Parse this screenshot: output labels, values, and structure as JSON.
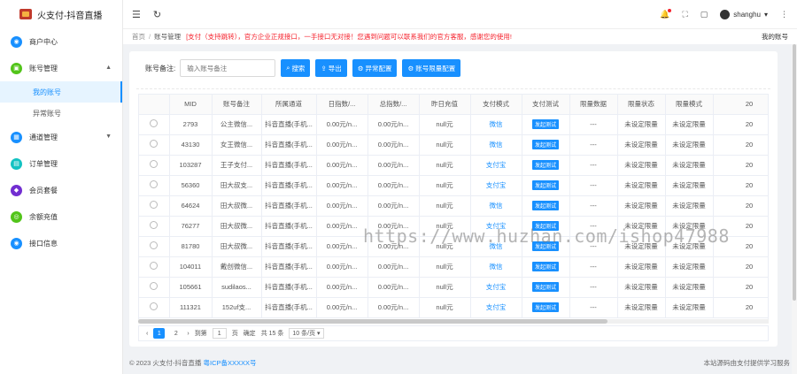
{
  "app": {
    "title": "火支付-抖音直播"
  },
  "sidebar": {
    "items": [
      {
        "label": "商户中心",
        "color": "#1890ff",
        "glyph": "◉"
      },
      {
        "label": "账号管理",
        "color": "#52c41a",
        "glyph": "▣",
        "expanded": true,
        "children": [
          {
            "label": "我的账号",
            "active": true
          },
          {
            "label": "异常账号"
          }
        ]
      },
      {
        "label": "通道管理",
        "color": "#1890ff",
        "glyph": "▦"
      },
      {
        "label": "订单管理",
        "color": "#13c2c2",
        "glyph": "▤"
      },
      {
        "label": "会员套餐",
        "color": "#722ed1",
        "glyph": "◆"
      },
      {
        "label": "余额充值",
        "color": "#52c41a",
        "glyph": "◎"
      },
      {
        "label": "接口信息",
        "color": "#1890ff",
        "glyph": "◉"
      }
    ]
  },
  "header": {
    "username": "shanghu"
  },
  "breadcrumb": {
    "home": "首页",
    "current": "账号管理",
    "notice": "[支付（支持跳转），官方企业正规接口，一手接口无对接！您遇到问题可以联系我们的官方客服，感谢您的使用!",
    "tab": "我的账号"
  },
  "toolbar": {
    "label": "账号备注:",
    "placeholder": "输入账号备注",
    "search": "搜索",
    "export": "导出",
    "abnormal": "异常配置",
    "limit": "账号限量配置"
  },
  "table": {
    "headers": [
      "",
      "MID",
      "账号备注",
      "所属通道",
      "日指数/...",
      "总指数/...",
      "昨日充值",
      "支付模式",
      "支付测试",
      "限量数据",
      "限量状态",
      "限量模式",
      "20"
    ],
    "rows": [
      {
        "mid": "2793",
        "remark": "公主微信...",
        "channel": "抖音直播(手机...",
        "day": "0.00元/n...",
        "total": "0.00元/n...",
        "yesterday": "null元",
        "mode": "微信",
        "test": "发起测试",
        "limit_data": "---",
        "limit_status": "未设定限量",
        "limit_mode": "未设定限量",
        "extra": "20"
      },
      {
        "mid": "43130",
        "remark": "女王微信...",
        "channel": "抖音直播(手机...",
        "day": "0.00元/n...",
        "total": "0.00元/n...",
        "yesterday": "null元",
        "mode": "微信",
        "test": "发起测试",
        "limit_data": "---",
        "limit_status": "未设定限量",
        "limit_mode": "未设定限量",
        "extra": "20"
      },
      {
        "mid": "103287",
        "remark": "王子支付...",
        "channel": "抖音直播(手机...",
        "day": "0.00元/n...",
        "total": "0.00元/n...",
        "yesterday": "null元",
        "mode": "支付宝",
        "test": "发起测试",
        "limit_data": "---",
        "limit_status": "未设定限量",
        "limit_mode": "未设定限量",
        "extra": "20"
      },
      {
        "mid": "56360",
        "remark": "田大叔支...",
        "channel": "抖音直播(手机...",
        "day": "0.00元/n...",
        "total": "0.00元/n...",
        "yesterday": "null元",
        "mode": "支付宝",
        "test": "发起测试",
        "limit_data": "---",
        "limit_status": "未设定限量",
        "limit_mode": "未设定限量",
        "extra": "20"
      },
      {
        "mid": "64624",
        "remark": "田大叔微...",
        "channel": "抖音直播(手机...",
        "day": "0.00元/n...",
        "total": "0.00元/n...",
        "yesterday": "null元",
        "mode": "微信",
        "test": "发起测试",
        "limit_data": "---",
        "limit_status": "未设定限量",
        "limit_mode": "未设定限量",
        "extra": "20"
      },
      {
        "mid": "76277",
        "remark": "田大叔微...",
        "channel": "抖音直播(手机...",
        "day": "0.00元/n...",
        "total": "0.00元/n...",
        "yesterday": "null元",
        "mode": "支付宝",
        "test": "发起测试",
        "limit_data": "---",
        "limit_status": "未设定限量",
        "limit_mode": "未设定限量",
        "extra": "20"
      },
      {
        "mid": "81780",
        "remark": "田大叔微...",
        "channel": "抖音直播(手机...",
        "day": "0.00元/n...",
        "total": "0.00元/n...",
        "yesterday": "null元",
        "mode": "微信",
        "test": "发起测试",
        "limit_data": "---",
        "limit_status": "未设定限量",
        "limit_mode": "未设定限量",
        "extra": "20"
      },
      {
        "mid": "104011",
        "remark": "戴创微信...",
        "channel": "抖音直播(手机...",
        "day": "0.00元/n...",
        "total": "0.00元/n...",
        "yesterday": "null元",
        "mode": "微信",
        "test": "发起测试",
        "limit_data": "---",
        "limit_status": "未设定限量",
        "limit_mode": "未设定限量",
        "extra": "20"
      },
      {
        "mid": "105661",
        "remark": "sudilaos...",
        "channel": "抖音直播(手机...",
        "day": "0.00元/n...",
        "total": "0.00元/n...",
        "yesterday": "null元",
        "mode": "支付宝",
        "test": "发起测试",
        "limit_data": "---",
        "limit_status": "未设定限量",
        "limit_mode": "未设定限量",
        "extra": "20"
      },
      {
        "mid": "111321",
        "remark": "152uf支...",
        "channel": "抖音直播(手机...",
        "day": "0.00元/n...",
        "total": "0.00元/n...",
        "yesterday": "null元",
        "mode": "支付宝",
        "test": "发起测试",
        "limit_data": "---",
        "limit_status": "未设定限量",
        "limit_mode": "未设定限量",
        "extra": "20"
      }
    ]
  },
  "pagination": {
    "pages": [
      "1",
      "2"
    ],
    "current": "1",
    "goto_label": "到第",
    "goto_value": "1",
    "page_unit": "页",
    "confirm": "确定",
    "total": "共 15 条",
    "page_size": "10 条/页"
  },
  "footer": {
    "copyright": "© 2023 火支付-抖音直播",
    "icp": "粤ICP备XXXXX号",
    "right": "本站源码由支付提供学习服务"
  },
  "watermark": "https://www.huzhan.com/ishop47988"
}
